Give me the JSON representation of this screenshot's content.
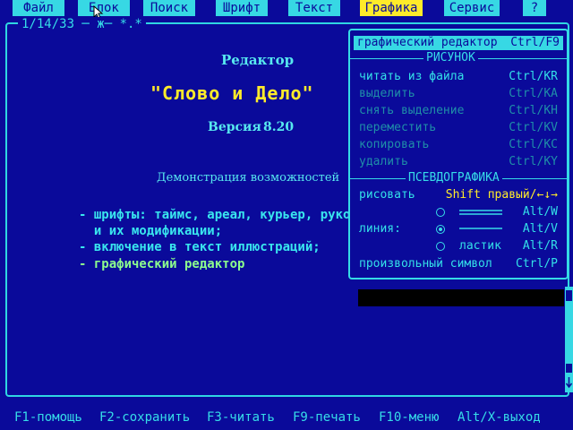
{
  "menu": [
    {
      "label": "Файл"
    },
    {
      "label": "Блок"
    },
    {
      "label": "Поиск"
    },
    {
      "label": "Шрифт"
    },
    {
      "label": "Текст"
    },
    {
      "label": "Графика"
    },
    {
      "label": "Сервис"
    },
    {
      "label": "?"
    }
  ],
  "frame_title": "1/14/33  ─ ж─ *.*",
  "doc": {
    "title": "Редактор",
    "product": "\"Слово и Дело\"",
    "version_label": "Версия",
    "version": "8.20",
    "demo": "Демонстрация возможностей",
    "bullets": [
      "- шрифты: таймс, ареал, курьер, рукоп",
      "  и их модификации;",
      "- включение в текст иллюстраций;",
      "- графический редактор"
    ]
  },
  "popup": {
    "selected": {
      "label": "графический редактор",
      "key": "Ctrl/F9"
    },
    "section1": "РИСУНОК",
    "items": [
      {
        "label": "читать из файла",
        "key": "Ctrl/KR"
      },
      {
        "label": "выделить",
        "key": "Ctrl/KA"
      },
      {
        "label": "снять выделение",
        "key": "Ctrl/KH"
      },
      {
        "label": "переместить",
        "key": "Ctrl/KV"
      },
      {
        "label": "копировать",
        "key": "Ctrl/KC"
      },
      {
        "label": "удалить",
        "key": "Ctrl/KY"
      }
    ],
    "section2": "ПСЕВДОГРАФИКА",
    "draw_label": "рисовать",
    "draw_key": "Shift правый/←↓→",
    "line_label": "линия:",
    "double_key": "Alt/W",
    "single_key": "Alt/V",
    "eraser_label": "ластик",
    "eraser_key": "Alt/R",
    "symbol_label": "произвольный символ",
    "symbol_key": "Ctrl/P"
  },
  "statusbar": [
    {
      "label": "F1-помощь"
    },
    {
      "label": "F2-сохранить"
    },
    {
      "label": "F3-читать"
    },
    {
      "label": "F9-печать"
    },
    {
      "label": "F10-меню"
    },
    {
      "label": "Alt/X-выход"
    }
  ],
  "colors": {
    "bg": "#0a0a9a",
    "cyan": "#37d8e4",
    "yellow": "#ffeb2a",
    "green": "#8dff8d"
  }
}
